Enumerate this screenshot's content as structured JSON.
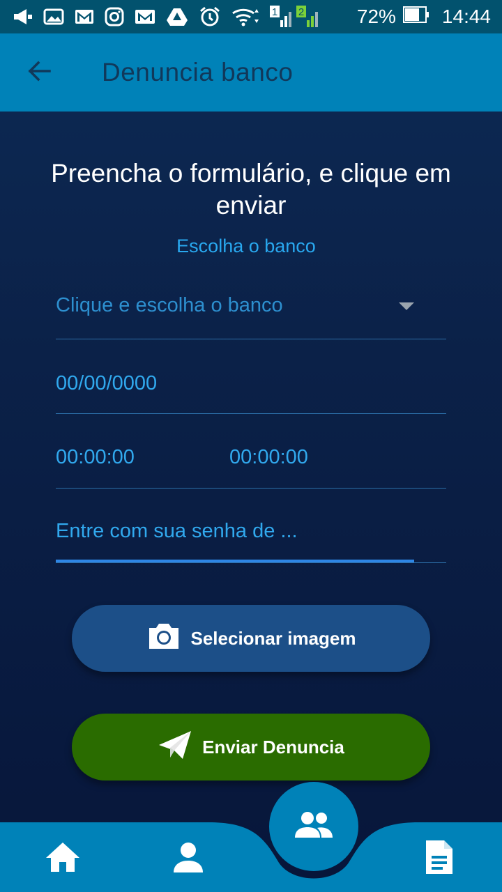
{
  "status_bar": {
    "battery": "72%",
    "time": "14:44",
    "sim1": "1",
    "sim2": "2",
    "icons": [
      "megaphone-icon",
      "image-icon",
      "gmail-icon",
      "instagram-icon",
      "mail-icon",
      "drive-icon",
      "alarm-icon",
      "wifi-icon",
      "signal-icon",
      "battery-icon"
    ]
  },
  "app_bar": {
    "title": "Denuncia banco",
    "back_icon": "arrow-left-icon"
  },
  "form": {
    "headline": "Preencha o formulário, e clique em enviar",
    "bank_label": "Escolha o banco",
    "bank_dropdown_placeholder": "Clique e escolha o banco",
    "date_value": "00/00/0000",
    "time_start_value": "00:00:00",
    "time_end_value": "00:00:00",
    "password_placeholder": "Entre com sua senha de ..."
  },
  "buttons": {
    "select_image": "Selecionar imagem",
    "send_report": "Enviar Denuncia"
  },
  "bottom_nav": {
    "items": [
      "home-icon",
      "person-icon",
      "people-icon",
      "document-icon"
    ],
    "active": "people-icon"
  },
  "colors": {
    "status_bar": "#02526e",
    "app_bar": "#0082b8",
    "title_text": "#11385a",
    "accent_text": "#29a8ef",
    "select_image_button": "#1c4f88",
    "send_button": "#2a6c00",
    "focus_underline": "#2e86e6"
  }
}
